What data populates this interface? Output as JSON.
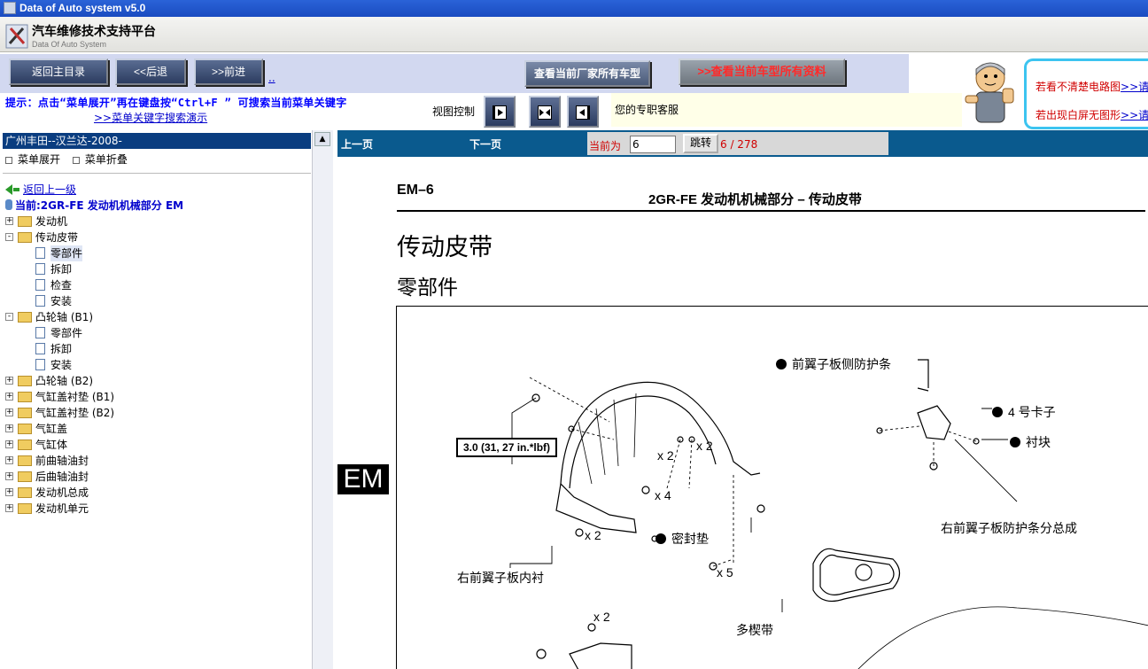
{
  "window": {
    "title": "Data of Auto system v5.0"
  },
  "app": {
    "title": "汽车维修技术支持平台",
    "subtitle": "Data Of Auto System"
  },
  "toolbar": {
    "home": "返回主目录",
    "back": "<<后退",
    "forward": ">>前进",
    "dots": "..",
    "vendor_models": "查看当前厂家所有车型",
    "view_all": "查看当前车型所有资料",
    "view_all_prefix": ">>"
  },
  "help": {
    "line1": "若看不清楚电路图",
    "line1_link": ">>请",
    "line2": "若出现白屏无图形",
    "line2_link": ">>请"
  },
  "tip": {
    "text": "提示：点击“菜单展开”再在键盘按“Ctrl+F ” 可搜索当前菜单关键字",
    "link": ">>菜单关键字搜索演示",
    "view_control": "视图控制",
    "service": "您的专职客服"
  },
  "sidebar": {
    "header": "广州丰田--汉兰达-2008-",
    "expand": "菜单展开",
    "collapse": "菜单折叠",
    "back": "返回上一级",
    "current": "当前:2GR-FE 发动机机械部分 EM",
    "tree": [
      {
        "label": "发动机",
        "type": "folder",
        "state": "+"
      },
      {
        "label": "传动皮带",
        "type": "folder",
        "state": "-"
      },
      {
        "label": "零部件",
        "type": "doc",
        "selected": true
      },
      {
        "label": "拆卸",
        "type": "doc"
      },
      {
        "label": "检查",
        "type": "doc"
      },
      {
        "label": "安装",
        "type": "doc"
      },
      {
        "label": "凸轮轴 (B1)",
        "type": "folder",
        "state": "-"
      },
      {
        "label": "零部件",
        "type": "doc"
      },
      {
        "label": "拆卸",
        "type": "doc"
      },
      {
        "label": "安装",
        "type": "doc"
      },
      {
        "label": "凸轮轴 (B2)",
        "type": "folder",
        "state": "+"
      },
      {
        "label": "气缸盖衬垫 (B1)",
        "type": "folder",
        "state": "+"
      },
      {
        "label": "气缸盖衬垫 (B2)",
        "type": "folder",
        "state": "+"
      },
      {
        "label": "气缸盖",
        "type": "folder",
        "state": "+"
      },
      {
        "label": "气缸体",
        "type": "folder",
        "state": "+"
      },
      {
        "label": "前曲轴油封",
        "type": "folder",
        "state": "+"
      },
      {
        "label": "后曲轴油封",
        "type": "folder",
        "state": "+"
      },
      {
        "label": "发动机总成",
        "type": "folder",
        "state": "+"
      },
      {
        "label": "发动机单元",
        "type": "folder",
        "state": "+"
      }
    ]
  },
  "nav": {
    "prev": "上一页",
    "next": "下一页",
    "page_label": "当前为",
    "page_value": "6",
    "go": "跳转",
    "page_count": "6 / 278"
  },
  "doc": {
    "section_tab": "EM",
    "code": "EM–6",
    "header": "2GR-FE 发动机机械部分 – 传动皮带",
    "title": "传动皮带",
    "subtitle": "零部件",
    "labels": {
      "fender_side_strip": "前翼子板侧防护条",
      "clip4": "4 号卡子",
      "pad": "衬块",
      "torque": "3.0 (31, 27 in.*lbf)",
      "x2a": "x 2",
      "x2b": "x 2",
      "x4": "x 4",
      "x2c": "x 2",
      "seal": "密封垫",
      "x5": "x 5",
      "right_fender_strip_assy": "右前翼子板防护条分总成",
      "right_fender_liner": "右前翼子板内衬",
      "belt": "多楔带",
      "x2d": "x 2"
    }
  }
}
